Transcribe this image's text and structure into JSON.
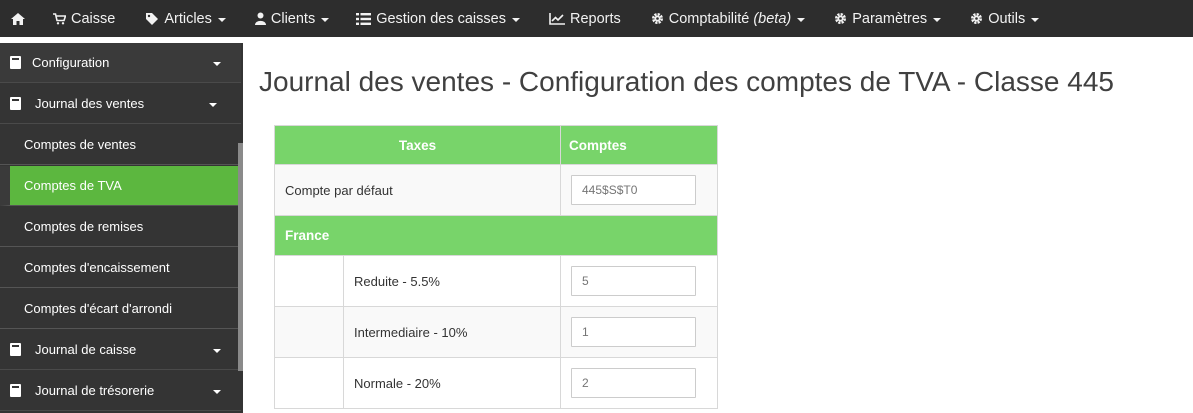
{
  "navbar": {
    "items": [
      {
        "icon": "home-icon",
        "label": ""
      },
      {
        "icon": "cart-icon",
        "label": "Caisse"
      },
      {
        "icon": "tag-icon",
        "label": "Articles",
        "dropdown": true
      },
      {
        "icon": "user-icon",
        "label": "Clients",
        "dropdown": true
      },
      {
        "icon": "list-icon",
        "label": "Gestion des caisses",
        "dropdown": true
      },
      {
        "icon": "chart-icon",
        "label": "Reports"
      },
      {
        "icon": "gear-icon",
        "label": "Comptabilité",
        "suffix": "(beta)",
        "dropdown": true
      },
      {
        "icon": "gear-icon",
        "label": "Paramètres",
        "dropdown": true
      },
      {
        "icon": "gear-icon",
        "label": "Outils",
        "dropdown": true
      }
    ]
  },
  "sidebar": {
    "configuration": "Configuration",
    "journal_ventes": "Journal des ventes",
    "subitems": [
      "Comptes de ventes",
      "Comptes de TVA",
      "Comptes de remises",
      "Comptes d'encaissement",
      "Comptes d'écart d'arrondi"
    ],
    "active_index": 1,
    "journal_caisse": "Journal de caisse",
    "journal_tresorerie": "Journal de trésorerie"
  },
  "main": {
    "title": "Journal des ventes - Configuration des comptes de TVA - Classe 445",
    "table": {
      "header_taxes": "Taxes",
      "header_comptes": "Comptes",
      "default_label": "Compte par défaut",
      "default_placeholder": "445$S$T0",
      "group": "France",
      "rows": [
        {
          "label": "Reduite - 5.5%",
          "value": "5"
        },
        {
          "label": "Intermediaire - 10%",
          "value": "1"
        },
        {
          "label": "Normale - 20%",
          "value": "2"
        }
      ]
    }
  },
  "colors": {
    "navbar": "#2d2d2d",
    "sidebar": "#343434",
    "accent_green": "#5cb73f",
    "table_header_green": "#78d46a"
  }
}
